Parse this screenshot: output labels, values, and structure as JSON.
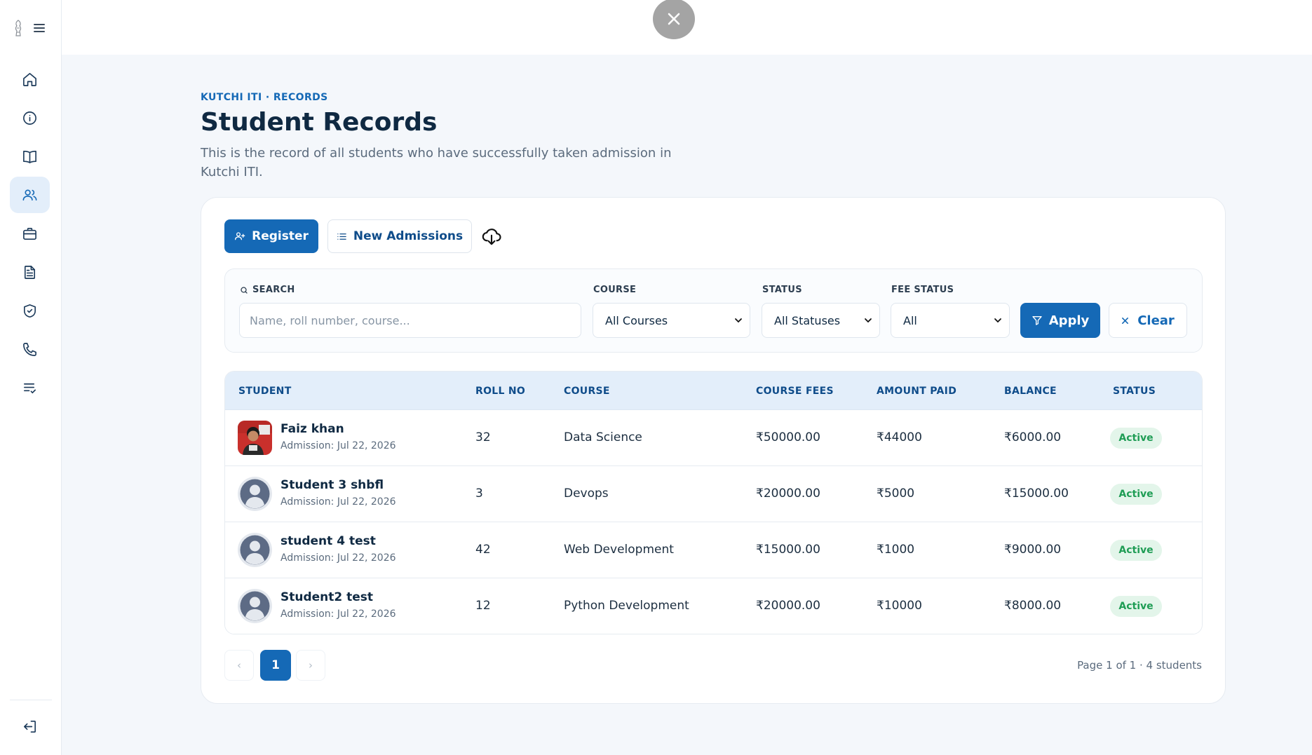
{
  "sidebar": {
    "items": [
      {
        "name": "home-icon",
        "active": false
      },
      {
        "name": "info-icon",
        "active": false
      },
      {
        "name": "book-icon",
        "active": false
      },
      {
        "name": "users-icon",
        "active": true
      },
      {
        "name": "briefcase-icon",
        "active": false
      },
      {
        "name": "document-icon",
        "active": false
      },
      {
        "name": "shield-icon",
        "active": false
      },
      {
        "name": "phone-icon",
        "active": false
      },
      {
        "name": "list-check-icon",
        "active": false
      }
    ],
    "logout_icon": "logout-icon"
  },
  "header": {
    "eyebrow": "KUTCHI ITI · RECORDS",
    "title": "Student Records",
    "description": "This is the record of all students who have successfully taken admission in Kutchi ITI."
  },
  "toolbar": {
    "register_label": "Register",
    "new_admissions_label": "New Admissions"
  },
  "filters": {
    "search_label": "SEARCH",
    "search_placeholder": "Name, roll number, course...",
    "course_label": "COURSE",
    "course_value": "All Courses",
    "status_label": "STATUS",
    "status_value": "All Statuses",
    "fee_status_label": "FEE STATUS",
    "fee_status_value": "All",
    "apply_label": "Apply",
    "clear_label": "Clear"
  },
  "table": {
    "headers": [
      "STUDENT",
      "ROLL NO",
      "COURSE",
      "COURSE FEES",
      "AMOUNT PAID",
      "BALANCE",
      "STATUS"
    ],
    "rows": [
      {
        "name": "Faiz khan",
        "admission": "Admission: Jul 22, 2026",
        "roll": "32",
        "course": "Data Science",
        "fees": "₹50000.00",
        "paid": "₹44000",
        "balance": "₹6000.00",
        "status": "Active",
        "photo": true
      },
      {
        "name": "Student 3 shbfl",
        "admission": "Admission: Jul 22, 2026",
        "roll": "3",
        "course": "Devops",
        "fees": "₹20000.00",
        "paid": "₹5000",
        "balance": "₹15000.00",
        "status": "Active",
        "photo": false
      },
      {
        "name": "student 4 test",
        "admission": "Admission: Jul 22, 2026",
        "roll": "42",
        "course": "Web Development",
        "fees": "₹15000.00",
        "paid": "₹1000",
        "balance": "₹9000.00",
        "status": "Active",
        "photo": false
      },
      {
        "name": "Student2 test",
        "admission": "Admission: Jul 22, 2026",
        "roll": "12",
        "course": "Python Development",
        "fees": "₹20000.00",
        "paid": "₹10000",
        "balance": "₹8000.00",
        "status": "Active",
        "photo": false
      }
    ]
  },
  "pagination": {
    "prev": "‹",
    "current": "1",
    "next": "›",
    "info": "Page 1 of 1 · 4 students"
  },
  "colors": {
    "accent": "#1569b6",
    "heading": "#0f2942",
    "status_active_bg": "#e3f5ea",
    "status_active_text": "#1f9d55"
  }
}
